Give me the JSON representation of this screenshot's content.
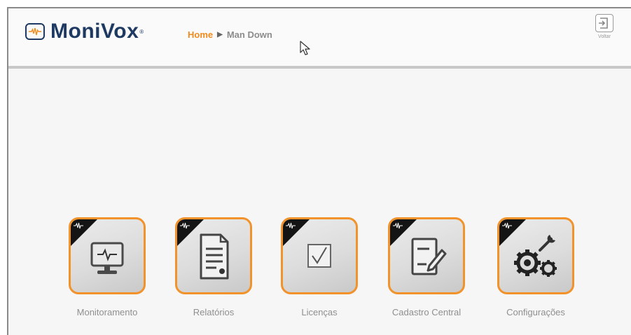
{
  "app": {
    "brand": "MoniVox",
    "brand_mark": "®"
  },
  "breadcrumb": {
    "home": "Home",
    "separator": "▶",
    "current": "Man Down"
  },
  "header": {
    "back_label": "Voltar"
  },
  "tiles": [
    {
      "label": "Monitoramento",
      "icon": "monitor-icon"
    },
    {
      "label": "Relatórios",
      "icon": "report-icon"
    },
    {
      "label": "Licenças",
      "icon": "checkbox-icon"
    },
    {
      "label": "Cadastro Central",
      "icon": "edit-form-icon"
    },
    {
      "label": "Configurações",
      "icon": "gears-icon"
    }
  ],
  "colors": {
    "brand_navy": "#1e3a63",
    "accent_orange": "#f08a1c",
    "tile_border": "#f2922a",
    "label_gray": "#8f8f8f"
  }
}
